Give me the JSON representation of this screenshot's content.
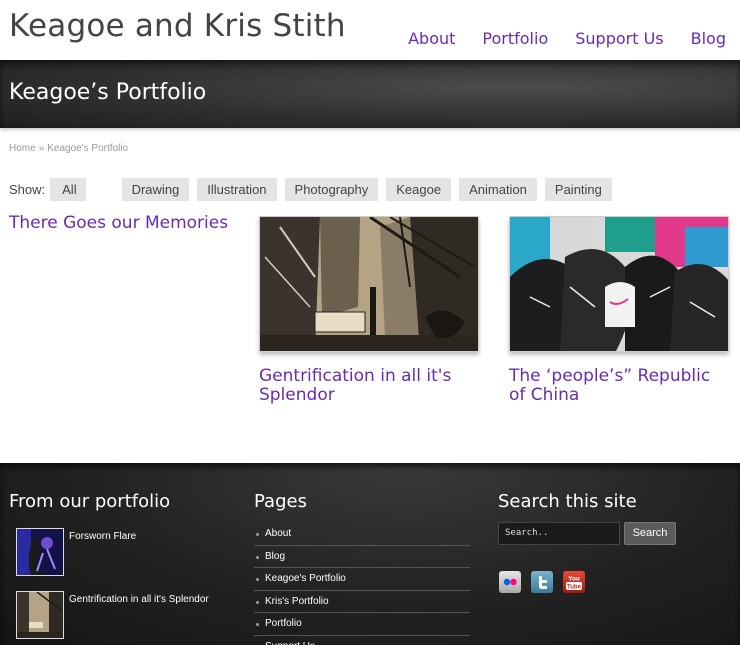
{
  "header": {
    "site_title": "Keagoe and Kris Stith",
    "nav": [
      "About",
      "Portfolio",
      "Support Us",
      "Blog"
    ]
  },
  "page": {
    "title": "Keagoe’s Portfolio"
  },
  "breadcrumb": {
    "home": "Home",
    "separator": "»",
    "current": "Keagoe's Portfolio"
  },
  "filter": {
    "label": "Show:",
    "options": [
      "All",
      "Drawing",
      "Illustration",
      "Photography",
      "Keagoe",
      "Animation",
      "Painting"
    ]
  },
  "portfolio": {
    "items": [
      {
        "title": "There Goes our Memories"
      },
      {
        "title": "Gentrification in all it's Splendor"
      },
      {
        "title": "The ‘people’s” Republic of China"
      }
    ]
  },
  "footer": {
    "portfolio_heading": "From our portfolio",
    "portfolio_items": [
      {
        "label": "Forsworn Flare"
      },
      {
        "label": "Gentrification in all it's Splendor"
      }
    ],
    "pages_heading": "Pages",
    "pages": [
      "About",
      "Blog",
      "Keagoe's Portfolio",
      "Kris's Portfolio",
      "Portfolio",
      "Support Us"
    ],
    "search_heading": "Search this site",
    "search_placeholder": "Search..",
    "search_button": "Search",
    "social": {
      "flickr": "flickr-icon",
      "twitter": "twitter-icon",
      "youtube": "youtube-icon",
      "youtube_text": "You Tube"
    }
  },
  "colors": {
    "accent": "#6a2bb0"
  }
}
